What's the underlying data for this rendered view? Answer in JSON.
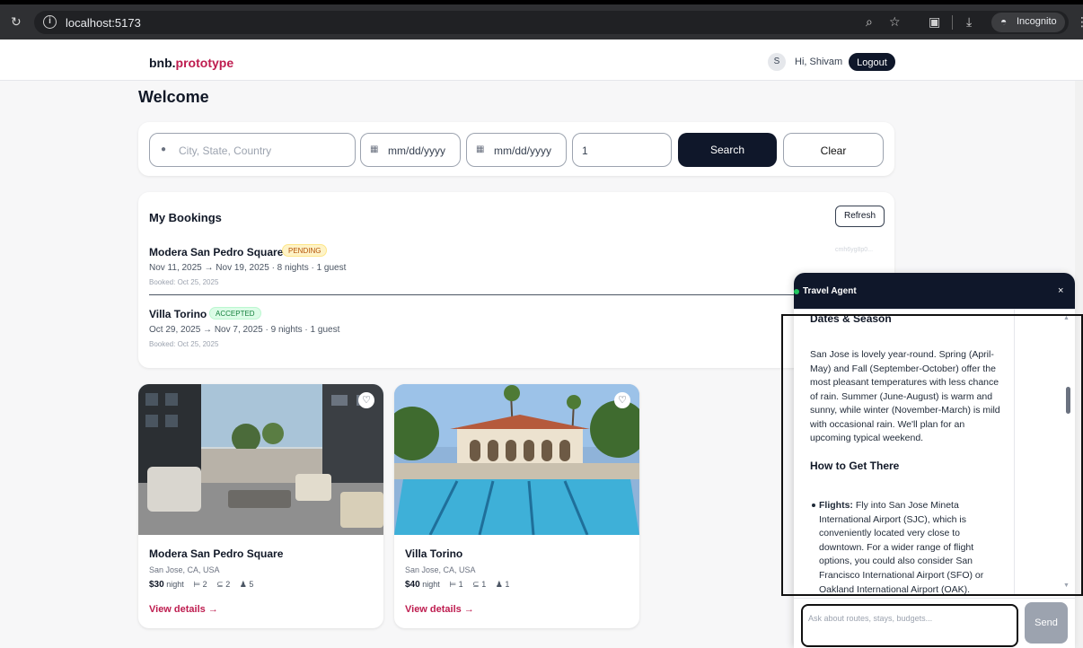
{
  "browser": {
    "url": "localhost:5173",
    "incognito_label": "Incognito"
  },
  "header": {
    "brand_main": "bnb.",
    "brand_accent": "prototype",
    "avatar_initial": "S",
    "greeting": "Hi, Shivam",
    "logout_label": "Logout"
  },
  "welcome": "Welcome",
  "search": {
    "location_placeholder": "City, State, Country",
    "checkin": "mm/dd/yyyy",
    "checkout": "mm/dd/yyyy",
    "guests": "1",
    "search_label": "Search",
    "clear_label": "Clear"
  },
  "bookings": {
    "title": "My Bookings",
    "refresh_label": "Refresh",
    "items": [
      {
        "name": "Modera San Pedro Square",
        "status": "PENDING",
        "dates": "Nov 11, 2025 → Nov 19, 2025 · 8 nights · 1 guest",
        "booked": "Booked: Oct 25, 2025",
        "id": "cmh6yg8p0..."
      },
      {
        "name": "Villa Torino",
        "status": "ACCEPTED",
        "dates": "Oct 29, 2025 → Nov 7, 2025 · 9 nights · 1 guest",
        "booked": "Booked: Oct 25, 2025"
      }
    ]
  },
  "listings": [
    {
      "name": "Modera San Pedro Square",
      "location": "San Jose, CA, USA",
      "price": "$30",
      "unit": "night",
      "beds": "2",
      "baths": "2",
      "guests": "5",
      "link": "View details →"
    },
    {
      "name": "Villa Torino",
      "location": "San Jose, CA, USA",
      "price": "$40",
      "unit": "night",
      "beds": "1",
      "baths": "1",
      "guests": "1",
      "link": "View details →"
    }
  ],
  "chat": {
    "title": "Travel Agent",
    "close": "×",
    "section1": "Dates & Season",
    "paragraph": "San Jose is lovely year-round. Spring (April-May) and Fall (September-October) offer the most pleasant temperatures with less chance of rain. Summer (June-August) is warm and sunny, while winter (November-March) is mild with occasional rain. We'll plan for an upcoming typical weekend.",
    "section2": "How to Get There",
    "bullet_label": "Flights:",
    "bullet_text": " Fly into San Jose Mineta International Airport (SJC), which is conveniently located very close to downtown. For a wider range of flight options, you could also consider San Francisco International Airport (SFO) or Oakland International Airport (OAK).",
    "input_placeholder": "Ask about routes, stays, budgets...",
    "send_label": "Send"
  },
  "colors": {
    "accent": "#be1c4f",
    "dark": "#0f172a",
    "pending": "#fef3c7",
    "accepted": "#dcfce7",
    "online": "#22c55e"
  }
}
